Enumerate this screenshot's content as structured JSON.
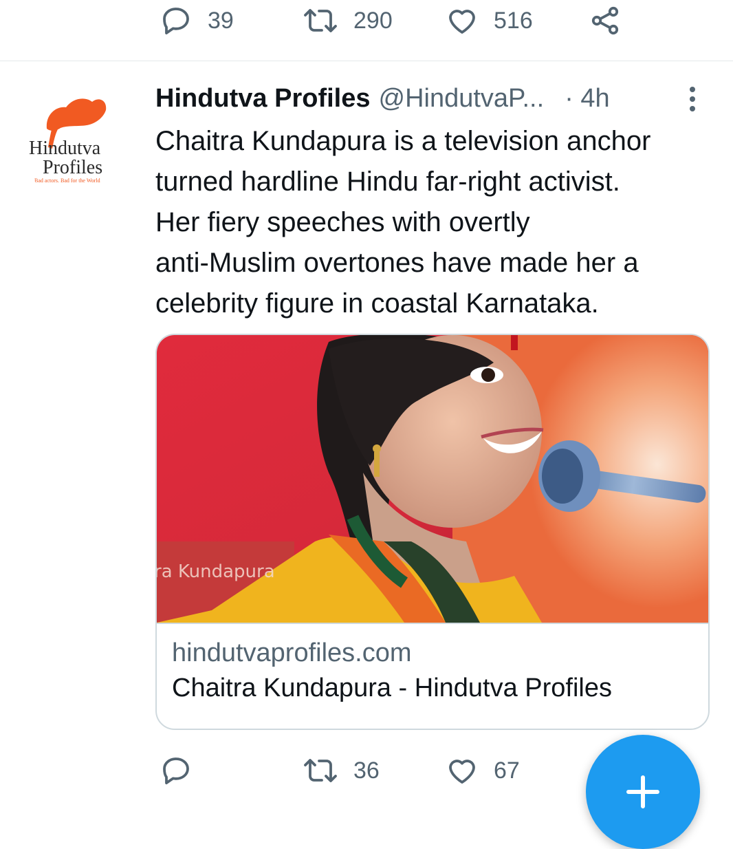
{
  "top_actions": {
    "reply_count": "39",
    "retweet_count": "290",
    "like_count": "516"
  },
  "tweet": {
    "author_name": "Hindutva Profiles",
    "handle": "@HindutvaP...",
    "time": "· 4h",
    "text_lines": [
      "Chaitra Kundapura is a television anchor",
      "turned hardline Hindu far-right activist.",
      "Her fiery speeches with overtly",
      "anti-Muslim overtones have made her a",
      "celebrity figure in coastal Karnataka."
    ],
    "avatar_logo": {
      "line1": "Hindutva",
      "line2": "Profiles",
      "tagline": "Bad actors. Bad for the World"
    },
    "card": {
      "image_watermark": "ra Kundapura",
      "domain": "hindutvaprofiles.com",
      "title": "Chaitra Kundapura - Hindutva Profiles"
    },
    "actions": {
      "reply_count": "",
      "retweet_count": "36",
      "like_count": "67"
    }
  },
  "colors": {
    "accent": "#1d9bf0",
    "muted_text": "#536471",
    "text": "#0f1419",
    "border": "#cfd9de",
    "logo_orange": "#f15a22"
  },
  "icons": [
    "reply-icon",
    "retweet-icon",
    "like-icon",
    "share-icon",
    "more-icon",
    "compose-plus-icon"
  ]
}
